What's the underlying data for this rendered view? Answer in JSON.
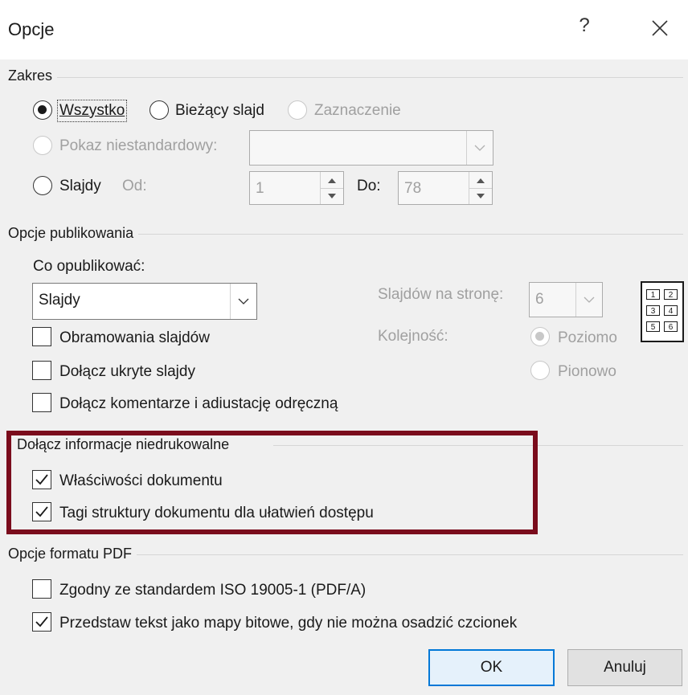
{
  "window": {
    "title": "Opcje",
    "help_label": "?"
  },
  "zakres": {
    "heading": "Zakres",
    "all": "Wszystko",
    "current": "Bieżący slajd",
    "selection": "Zaznaczenie",
    "custom_show": "Pokaz niestandardowy:",
    "slides": "Slajdy",
    "from_label": "Od:",
    "from_value": "1",
    "to_label": "Do:",
    "to_value": "78",
    "selected": "Wszystko"
  },
  "publish": {
    "heading": "Opcje publikowania",
    "what_label": "Co opublikować:",
    "what_value": "Slajdy",
    "frame_slides": "Obramowania slajdów",
    "include_hidden": "Dołącz ukryte slajdy",
    "include_comments": "Dołącz komentarze i adiustację odręczną",
    "per_page_label": "Slajdów na stronę:",
    "per_page_value": "6",
    "order_label": "Kolejność:",
    "horizontal": "Poziomo",
    "vertical": "Pionowo",
    "grid_numbers": [
      "1",
      "2",
      "3",
      "4",
      "5",
      "6"
    ]
  },
  "nonprint": {
    "heading": "Dołącz informacje niedrukowalne",
    "doc_props": "Właściwości dokumentu",
    "doc_props_checked": true,
    "struct_tags": "Tagi struktury dokumentu dla ułatwień dostępu",
    "struct_tags_checked": true,
    "highlight_color": "#7a0c1c"
  },
  "pdf": {
    "heading": "Opcje formatu PDF",
    "iso": "Zgodny ze standardem ISO 19005-1 (PDF/A)",
    "iso_checked": false,
    "bitmap": "Przedstaw tekst jako mapy bitowe, gdy nie można osadzić czcionek",
    "bitmap_checked": true
  },
  "buttons": {
    "ok": "OK",
    "cancel": "Anuluj"
  },
  "colors": {
    "accent": "#0078d7",
    "dialog_bg": "#f0f0f0"
  }
}
